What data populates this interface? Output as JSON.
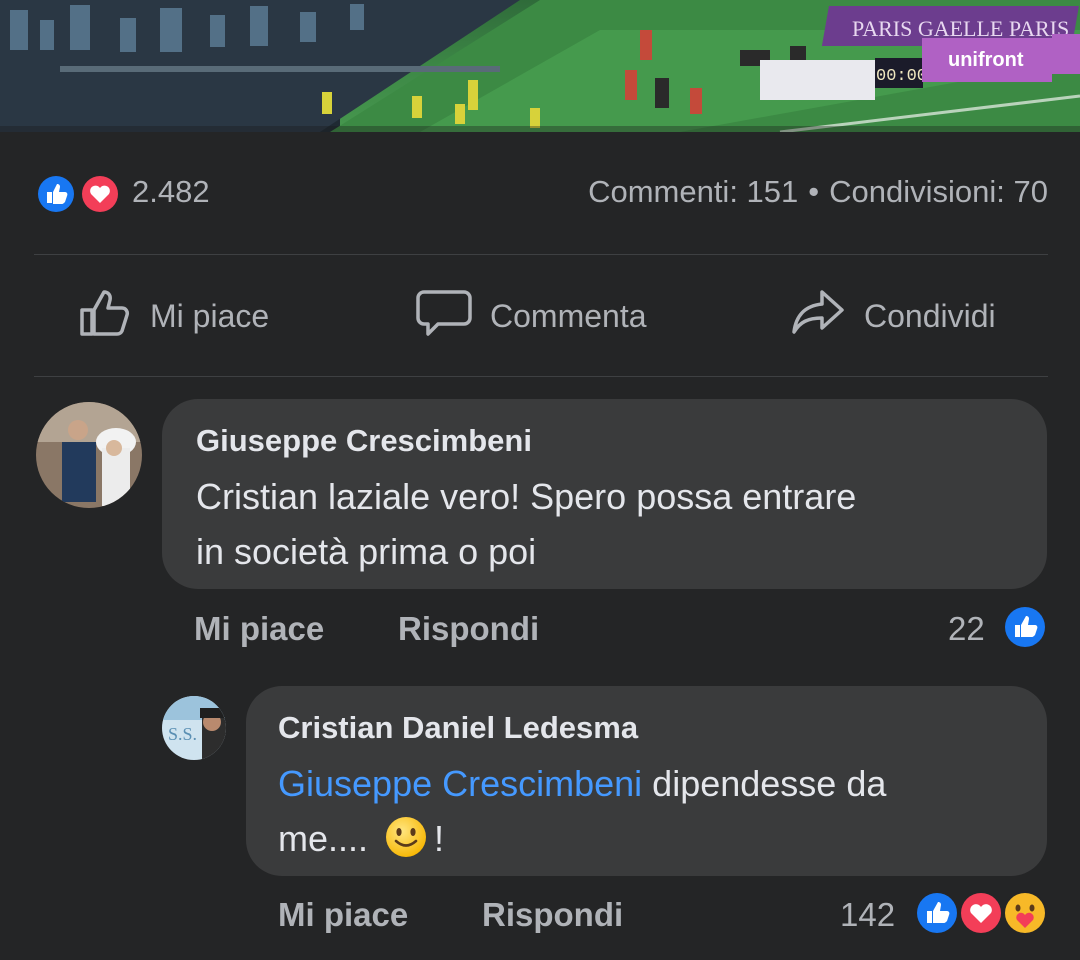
{
  "post": {
    "reactions_count": "2.482",
    "comments_label": "Commenti: 151",
    "separator": "•",
    "shares_label": "Condivisioni: 70",
    "reaction_types": [
      "like",
      "love"
    ]
  },
  "actions": {
    "like_label": "Mi piace",
    "comment_label": "Commenta",
    "share_label": "Condividi"
  },
  "comments": [
    {
      "author": "Giuseppe Crescimbeni",
      "text_line1": "Cristian laziale vero! Spero possa entrare",
      "text_line2": "in società prima o poi",
      "like_label": "Mi piace",
      "reply_label": "Rispondi",
      "reaction_count": "22",
      "reaction_types": [
        "like"
      ]
    },
    {
      "author": "Cristian Daniel Ledesma",
      "mention": "Giuseppe Crescimbeni",
      "text_after_mention": " dipendesse da",
      "text_line2_before": "me....",
      "text_line2_after": "!",
      "emoji": "slightly-smiling-face",
      "like_label": "Mi piace",
      "reply_label": "Rispondi",
      "reaction_count": "142",
      "reaction_types": [
        "like",
        "love",
        "care"
      ]
    }
  ],
  "image": {
    "banner_text_1": "PARIS GAELLE PARIS",
    "banner_text_2": "PARIS GAELLE PARIS",
    "led_clock": "00:00",
    "sponsor": "unifront"
  },
  "colors": {
    "background": "#242526",
    "bubble": "#3a3b3c",
    "text_primary": "#e4e6eb",
    "text_secondary": "#b0b3b8",
    "mention": "#4599ff",
    "like_blue": "#1877f2",
    "love_red": "#f33e58"
  }
}
